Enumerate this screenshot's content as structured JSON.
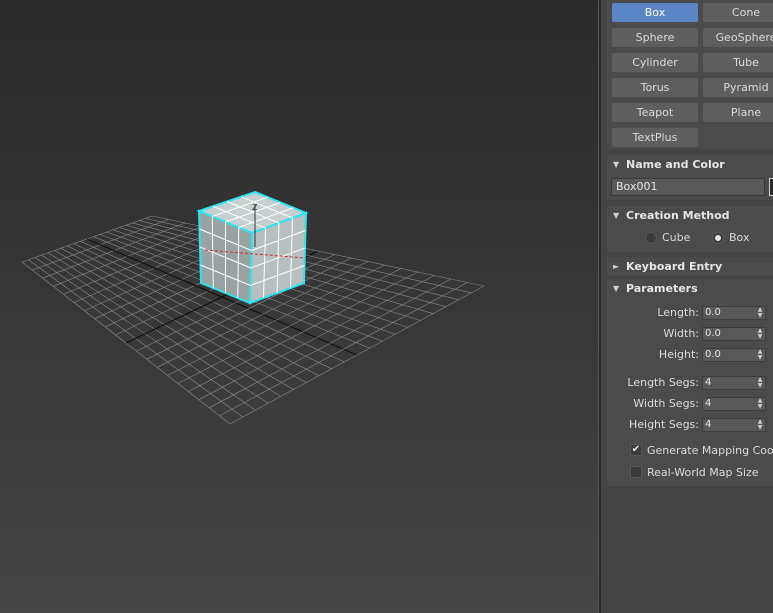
{
  "viewport": {
    "axis_label": "Z",
    "colors": {
      "grid": "#8a8a8a",
      "grid_axis": "#111111",
      "box_selection": "#29e5f0",
      "box_face_top": "#c8cfd0",
      "box_face_front": "#9aa3a4",
      "box_face_side": "#b7bfc0",
      "red_axis": "#c03030"
    }
  },
  "object_types": {
    "buttons": [
      {
        "label": "Box",
        "selected": true
      },
      {
        "label": "Cone",
        "selected": false
      },
      {
        "label": "Sphere",
        "selected": false
      },
      {
        "label": "GeoSphere",
        "selected": false
      },
      {
        "label": "Cylinder",
        "selected": false
      },
      {
        "label": "Tube",
        "selected": false
      },
      {
        "label": "Torus",
        "selected": false
      },
      {
        "label": "Pyramid",
        "selected": false
      },
      {
        "label": "Teapot",
        "selected": false
      },
      {
        "label": "Plane",
        "selected": false
      },
      {
        "label": "TextPlus",
        "selected": false
      }
    ]
  },
  "name_and_color": {
    "title": "Name and Color",
    "name_value": "Box001",
    "color": "#2a2a2a"
  },
  "creation_method": {
    "title": "Creation Method",
    "options": [
      {
        "label": "Cube",
        "checked": false
      },
      {
        "label": "Box",
        "checked": true
      }
    ]
  },
  "keyboard_entry": {
    "title": "Keyboard Entry"
  },
  "parameters": {
    "title": "Parameters",
    "length_label": "Length:",
    "length_value": "0.0",
    "width_label": "Width:",
    "width_value": "0.0",
    "height_label": "Height:",
    "height_value": "0.0",
    "length_segs_label": "Length Segs:",
    "length_segs_value": "4",
    "width_segs_label": "Width Segs:",
    "width_segs_value": "4",
    "height_segs_label": "Height Segs:",
    "height_segs_value": "4",
    "generate_mapping_label": "Generate Mapping Coords.",
    "generate_mapping_checked": true,
    "real_world_label": "Real-World Map Size",
    "real_world_checked": false
  },
  "icons": {
    "collapse_arrow": "triangle-down-icon",
    "expand_arrow": "triangle-right-icon",
    "spinner_arrows": "spinner-arrows-icon",
    "check": "checkmark-icon"
  }
}
